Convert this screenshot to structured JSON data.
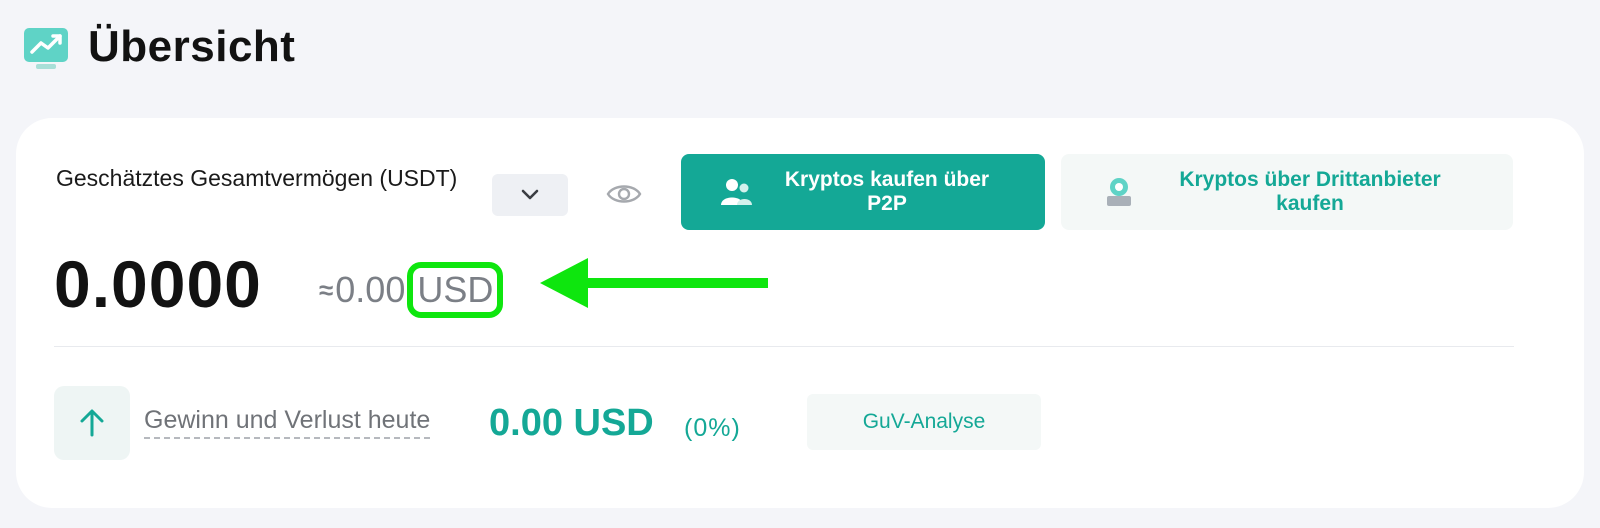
{
  "header": {
    "title": "Übersicht",
    "icon": "chart-monitor-icon"
  },
  "overview": {
    "total_label": "Geschätztes Gesamtvermögen (USDT)",
    "balance": "0.0000",
    "approx_prefix": "≈",
    "approx_value": "0.00",
    "approx_currency": "USD",
    "buy_p2p_label": "Kryptos kaufen über P2P",
    "buy_third_party_label": "Kryptos über Drittanbieter kaufen"
  },
  "pnl": {
    "label": "Gewinn und Verlust heute",
    "value": "0.00 USD",
    "percent": "(0%)",
    "analyse_label": "GuV-Analyse"
  },
  "colors": {
    "accent": "#14a896",
    "highlight": "#0ee60e",
    "background": "#f4f5f9"
  }
}
